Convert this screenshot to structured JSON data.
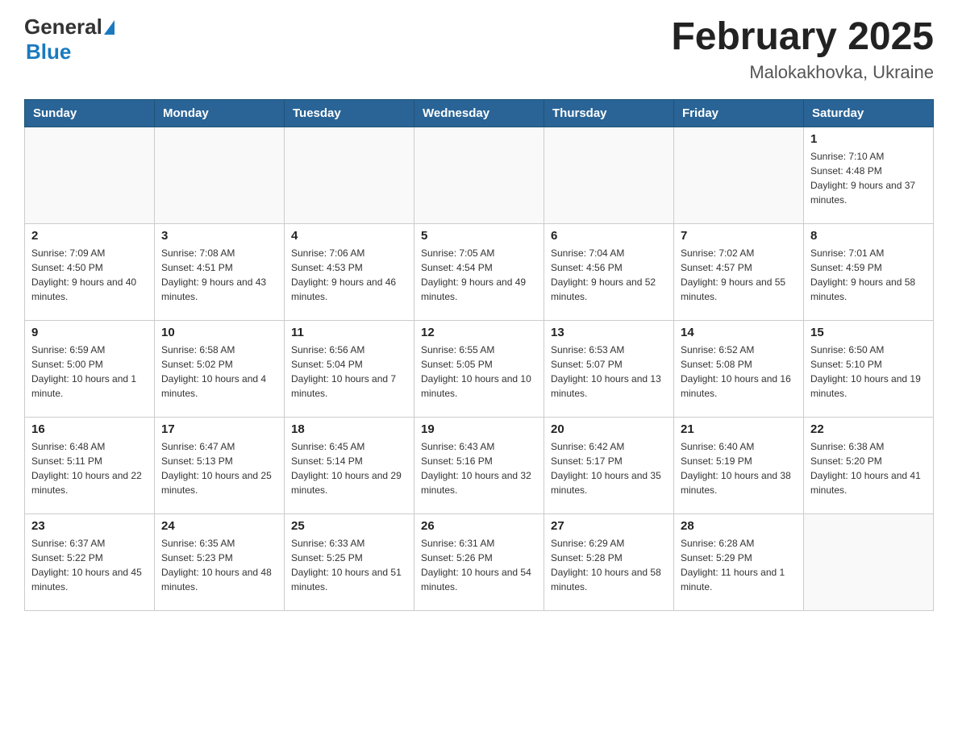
{
  "header": {
    "logo_text_general": "General",
    "logo_text_blue": "Blue",
    "title": "February 2025",
    "subtitle": "Malokakhovka, Ukraine"
  },
  "weekdays": [
    "Sunday",
    "Monday",
    "Tuesday",
    "Wednesday",
    "Thursday",
    "Friday",
    "Saturday"
  ],
  "weeks": [
    [
      {
        "day": "",
        "info": ""
      },
      {
        "day": "",
        "info": ""
      },
      {
        "day": "",
        "info": ""
      },
      {
        "day": "",
        "info": ""
      },
      {
        "day": "",
        "info": ""
      },
      {
        "day": "",
        "info": ""
      },
      {
        "day": "1",
        "info": "Sunrise: 7:10 AM\nSunset: 4:48 PM\nDaylight: 9 hours and 37 minutes."
      }
    ],
    [
      {
        "day": "2",
        "info": "Sunrise: 7:09 AM\nSunset: 4:50 PM\nDaylight: 9 hours and 40 minutes."
      },
      {
        "day": "3",
        "info": "Sunrise: 7:08 AM\nSunset: 4:51 PM\nDaylight: 9 hours and 43 minutes."
      },
      {
        "day": "4",
        "info": "Sunrise: 7:06 AM\nSunset: 4:53 PM\nDaylight: 9 hours and 46 minutes."
      },
      {
        "day": "5",
        "info": "Sunrise: 7:05 AM\nSunset: 4:54 PM\nDaylight: 9 hours and 49 minutes."
      },
      {
        "day": "6",
        "info": "Sunrise: 7:04 AM\nSunset: 4:56 PM\nDaylight: 9 hours and 52 minutes."
      },
      {
        "day": "7",
        "info": "Sunrise: 7:02 AM\nSunset: 4:57 PM\nDaylight: 9 hours and 55 minutes."
      },
      {
        "day": "8",
        "info": "Sunrise: 7:01 AM\nSunset: 4:59 PM\nDaylight: 9 hours and 58 minutes."
      }
    ],
    [
      {
        "day": "9",
        "info": "Sunrise: 6:59 AM\nSunset: 5:00 PM\nDaylight: 10 hours and 1 minute."
      },
      {
        "day": "10",
        "info": "Sunrise: 6:58 AM\nSunset: 5:02 PM\nDaylight: 10 hours and 4 minutes."
      },
      {
        "day": "11",
        "info": "Sunrise: 6:56 AM\nSunset: 5:04 PM\nDaylight: 10 hours and 7 minutes."
      },
      {
        "day": "12",
        "info": "Sunrise: 6:55 AM\nSunset: 5:05 PM\nDaylight: 10 hours and 10 minutes."
      },
      {
        "day": "13",
        "info": "Sunrise: 6:53 AM\nSunset: 5:07 PM\nDaylight: 10 hours and 13 minutes."
      },
      {
        "day": "14",
        "info": "Sunrise: 6:52 AM\nSunset: 5:08 PM\nDaylight: 10 hours and 16 minutes."
      },
      {
        "day": "15",
        "info": "Sunrise: 6:50 AM\nSunset: 5:10 PM\nDaylight: 10 hours and 19 minutes."
      }
    ],
    [
      {
        "day": "16",
        "info": "Sunrise: 6:48 AM\nSunset: 5:11 PM\nDaylight: 10 hours and 22 minutes."
      },
      {
        "day": "17",
        "info": "Sunrise: 6:47 AM\nSunset: 5:13 PM\nDaylight: 10 hours and 25 minutes."
      },
      {
        "day": "18",
        "info": "Sunrise: 6:45 AM\nSunset: 5:14 PM\nDaylight: 10 hours and 29 minutes."
      },
      {
        "day": "19",
        "info": "Sunrise: 6:43 AM\nSunset: 5:16 PM\nDaylight: 10 hours and 32 minutes."
      },
      {
        "day": "20",
        "info": "Sunrise: 6:42 AM\nSunset: 5:17 PM\nDaylight: 10 hours and 35 minutes."
      },
      {
        "day": "21",
        "info": "Sunrise: 6:40 AM\nSunset: 5:19 PM\nDaylight: 10 hours and 38 minutes."
      },
      {
        "day": "22",
        "info": "Sunrise: 6:38 AM\nSunset: 5:20 PM\nDaylight: 10 hours and 41 minutes."
      }
    ],
    [
      {
        "day": "23",
        "info": "Sunrise: 6:37 AM\nSunset: 5:22 PM\nDaylight: 10 hours and 45 minutes."
      },
      {
        "day": "24",
        "info": "Sunrise: 6:35 AM\nSunset: 5:23 PM\nDaylight: 10 hours and 48 minutes."
      },
      {
        "day": "25",
        "info": "Sunrise: 6:33 AM\nSunset: 5:25 PM\nDaylight: 10 hours and 51 minutes."
      },
      {
        "day": "26",
        "info": "Sunrise: 6:31 AM\nSunset: 5:26 PM\nDaylight: 10 hours and 54 minutes."
      },
      {
        "day": "27",
        "info": "Sunrise: 6:29 AM\nSunset: 5:28 PM\nDaylight: 10 hours and 58 minutes."
      },
      {
        "day": "28",
        "info": "Sunrise: 6:28 AM\nSunset: 5:29 PM\nDaylight: 11 hours and 1 minute."
      },
      {
        "day": "",
        "info": ""
      }
    ]
  ]
}
